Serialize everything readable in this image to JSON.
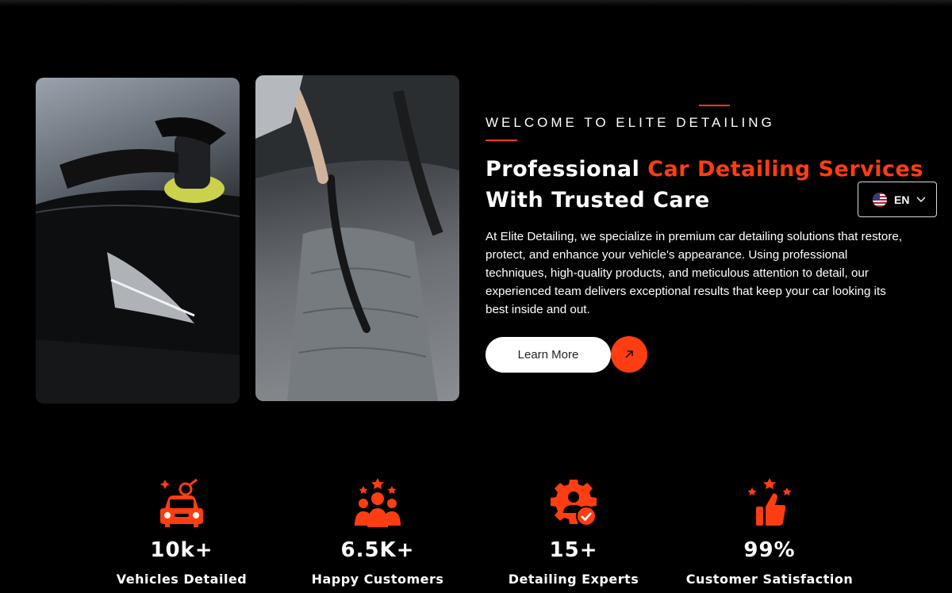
{
  "about": {
    "eyebrow": "WELCOME TO ELITE DETAILING",
    "headline_part1": "Professional ",
    "headline_highlight": "Car Detailing Services",
    "headline_part2": "With Trusted Care",
    "paragraph": "At Elite Detailing, we specialize in premium car detailing solutions that restore, protect, and enhance your vehicle's appearance. Using professional techniques, high-quality products, and meticulous attention to detail, our experienced team delivers exceptional results that keep your car looking its best inside and out.",
    "button_label": "Learn More",
    "button_icon": "arrow-up-right-icon"
  },
  "language": {
    "code": "EN",
    "flag": "us-flag-icon"
  },
  "stats": [
    {
      "value": "10k+",
      "label": "Vehicles Detailed",
      "icon": "car-service-icon"
    },
    {
      "value": "6.5K+",
      "label": "Happy Customers",
      "icon": "customers-group-icon"
    },
    {
      "value": "15+",
      "label": "Detailing Experts",
      "icon": "expert-badge-icon"
    },
    {
      "value": "99%",
      "label": "Customer Satisfaction",
      "icon": "thumbs-up-stars-icon"
    }
  ],
  "colors": {
    "accent": "#ff3d12",
    "background": "#000000",
    "text": "#ffffff"
  }
}
